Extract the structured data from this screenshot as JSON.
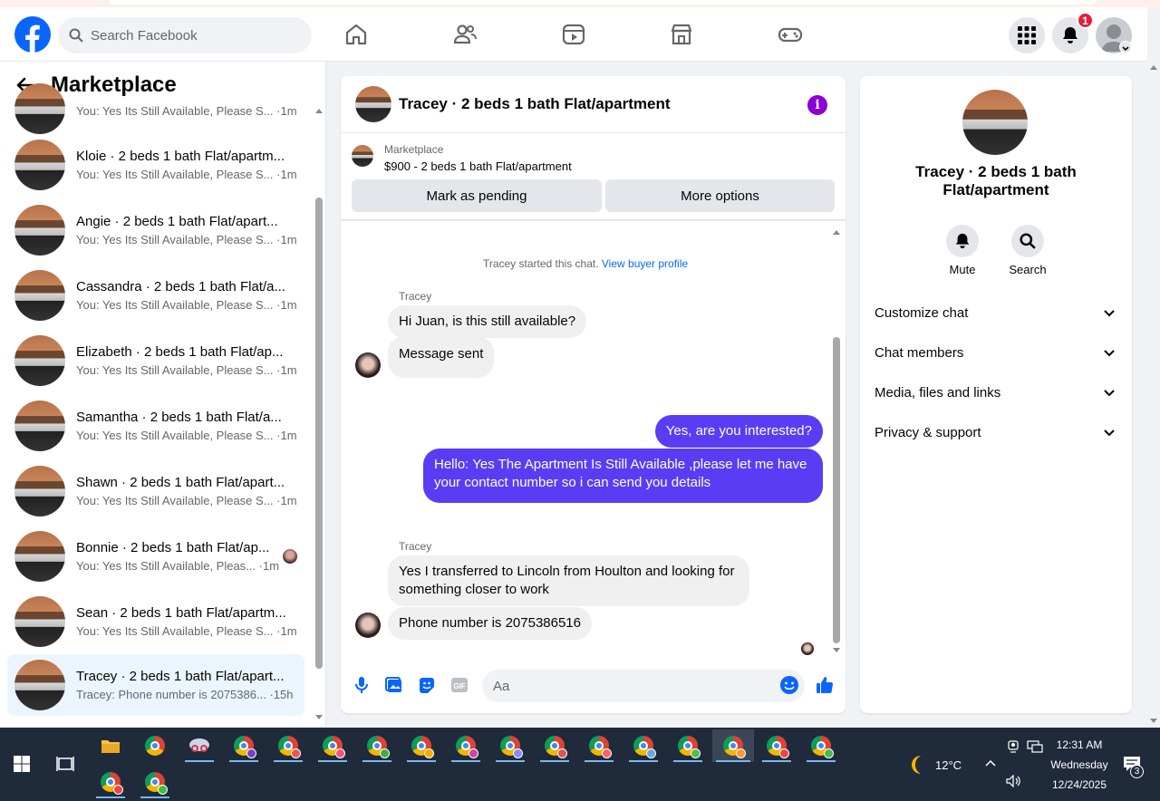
{
  "header": {
    "search_placeholder": "Search Facebook",
    "notifications_count": "1"
  },
  "left": {
    "title": "Marketplace",
    "conversations": [
      {
        "name": "",
        "sub": "You: Yes Its Still Available, Please S...",
        "time": "·1m"
      },
      {
        "name": "Kloie · 2 beds 1 bath Flat/apartm...",
        "sub": "You: Yes Its Still Available, Please S...",
        "time": "·1m"
      },
      {
        "name": "Angie · 2 beds 1 bath Flat/apart...",
        "sub": "You: Yes Its Still Available, Please S...",
        "time": "·1m"
      },
      {
        "name": "Cassandra · 2 beds 1 bath Flat/a...",
        "sub": "You: Yes Its Still Available, Please S...",
        "time": "·1m"
      },
      {
        "name": "Elizabeth · 2 beds 1 bath Flat/ap...",
        "sub": "You: Yes Its Still Available, Please S...",
        "time": "·1m"
      },
      {
        "name": "Samantha · 2 beds 1 bath Flat/a...",
        "sub": "You: Yes Its Still Available, Please S...",
        "time": "·1m"
      },
      {
        "name": "Shawn · 2 beds 1 bath Flat/apart...",
        "sub": "You: Yes Its Still Available, Please S...",
        "time": "·1m"
      },
      {
        "name": "Bonnie · 2 beds 1 bath Flat/ap...",
        "sub": "You: Yes Its Still Available, Pleas...",
        "time": "·1m"
      },
      {
        "name": "Sean · 2 beds 1 bath Flat/apartm...",
        "sub": "You: Yes Its Still Available, Please S...",
        "time": "·1m"
      },
      {
        "name": "Tracey · 2 beds 1 bath Flat/apart...",
        "sub": "Tracey: Phone number is 2075386...",
        "time": "·15h"
      }
    ]
  },
  "chat": {
    "title": "Tracey · 2 beds 1 bath Flat/apartment",
    "listing_label": "Marketplace",
    "listing_price": "$900 - 2 beds 1 bath Flat/apartment",
    "mark_pending": "Mark as pending",
    "more_options": "More options",
    "system_text": "Tracey started this chat.",
    "system_link": "View buyer profile",
    "sender": "Tracey",
    "messages": {
      "in1": "Hi Juan, is this still available?",
      "in2": "Message sent",
      "out1": "Yes, are you interested?",
      "out2": "Hello: Yes The Apartment Is Still Available ,please let me have your contact number so i can send you details",
      "in3": "Yes I transferred to Lincoln from Houlton and looking for something closer to work",
      "in4": "Phone number is 2075386516"
    },
    "composer_placeholder": "Aa"
  },
  "info": {
    "name": "Tracey · 2 beds 1 bath Flat/apartment",
    "mute": "Mute",
    "search": "Search",
    "sections": [
      "Customize chat",
      "Chat members",
      "Media, files and links",
      "Privacy & support"
    ]
  },
  "taskbar": {
    "temperature": "12°C",
    "time": "12:31 AM",
    "day": "Wednesday",
    "date": "12/24/2025",
    "notif_count": "3"
  },
  "colors": {
    "brand": "#0866ff",
    "outgoing_bubble": "#5b3cf5",
    "info_icon": "#8a00d4"
  }
}
